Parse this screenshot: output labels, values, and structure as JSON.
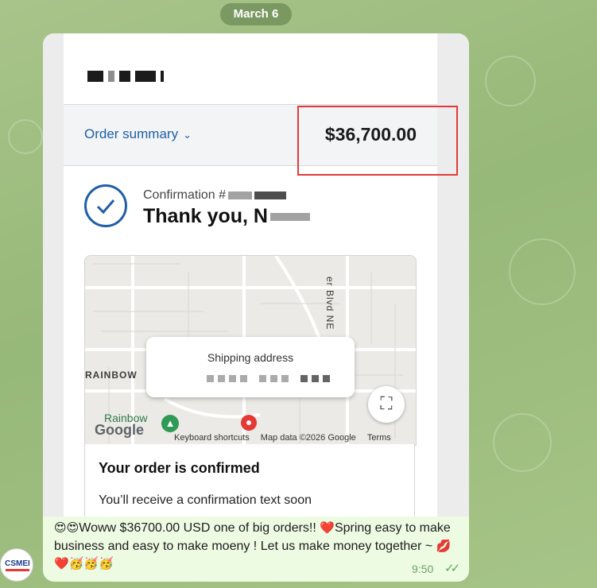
{
  "chat": {
    "date_pill": "March 6",
    "message_text_1": "Woww $36700.00 USD one of big orders!! ",
    "message_text_2": "Spring easy to make business and easy to make moeny ! Let us make money together ~",
    "emoji_lead": "😍😍",
    "emoji_heart": "❤️",
    "emoji_tail": "💋❤️🥳🥳🥳",
    "time": "9:50",
    "status_icon": "double-check-icon",
    "avatar_text": "CSMEI",
    "accent_color": "#5aa75a"
  },
  "screenshot": {
    "summary_label": "Order summary",
    "chevron": "⌄",
    "total_price": "$36,700.00",
    "confirmation_label": "Confirmation #",
    "thank_you": "Thank you, N",
    "map": {
      "street_label_1": "RAINBOW",
      "street_label_2": "er Blvd NE",
      "park_label": "Rainbow",
      "shipping_title": "Shipping address",
      "google": "Google",
      "keyboard_shortcuts": "Keyboard shortcuts",
      "map_data": "Map data ©2026 Google",
      "terms": "Terms",
      "fullscreen_icon": "⛶"
    },
    "confirmed_title": "Your order is confirmed",
    "confirmed_sub": "You’ll receive a confirmation text soon",
    "brand_color": "#1f5fa8",
    "highlight_color": "#e23a3a"
  }
}
